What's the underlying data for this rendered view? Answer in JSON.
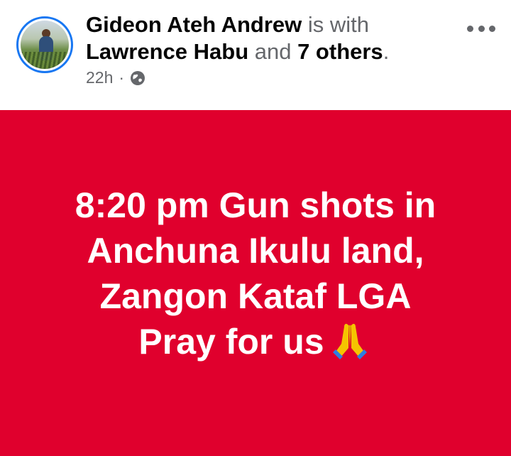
{
  "post": {
    "author": "Gideon Ateh Andrew",
    "with_text": " is with",
    "tagged_name": "Lawrence Habu",
    "and_text": " and ",
    "others": "7 others",
    "period": ".",
    "time": "22h",
    "separator": "·",
    "privacy_icon": "globe-icon",
    "menu_icon": "more-icon"
  },
  "content": {
    "background_color": "#e0002d",
    "lines": [
      "8:20 pm Gun shots in",
      "Anchuna Ikulu land,",
      "Zangon Kataf LGA",
      "Pray for us"
    ],
    "emoji": "🙏"
  }
}
